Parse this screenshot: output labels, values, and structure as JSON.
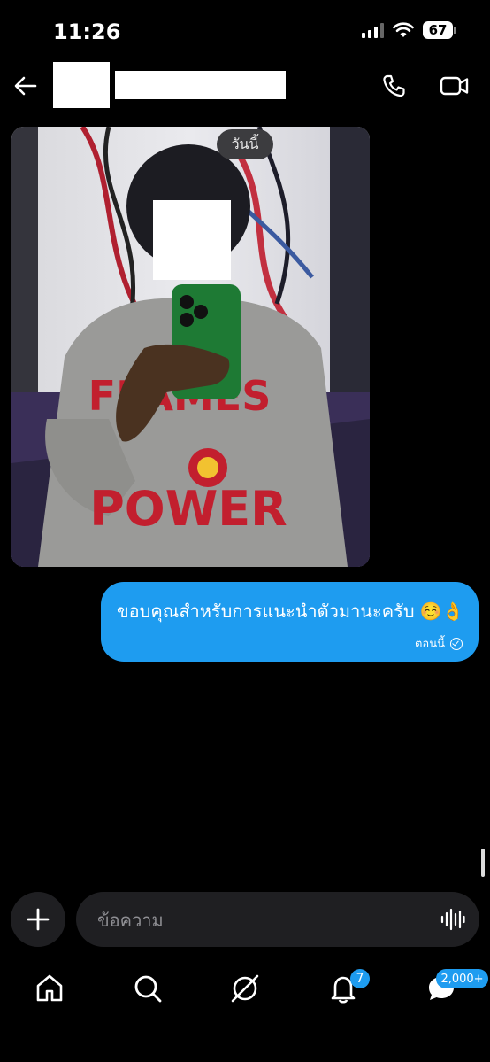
{
  "status_bar": {
    "time": "11:26",
    "battery": "67"
  },
  "header": {
    "back_icon": "arrow-left-icon",
    "call_icon": "phone-icon",
    "video_icon": "video-camera-icon"
  },
  "conversation": {
    "date_divider": "วันนี้",
    "sent_message": {
      "text": "ขอบคุณสำหรับการแนะนำตัวมานะครับ ☺️👌",
      "time": "ตอนนี้",
      "status_icon": "sent-check-icon"
    }
  },
  "composer": {
    "placeholder": "ข้อความ",
    "add_icon": "plus-icon",
    "voice_icon": "voice-waveform-icon"
  },
  "tabbar": {
    "items": [
      {
        "name": "home",
        "icon": "home-icon"
      },
      {
        "name": "search",
        "icon": "search-icon"
      },
      {
        "name": "explore",
        "icon": "compass-icon"
      },
      {
        "name": "notifications",
        "icon": "bell-icon",
        "badge": "7"
      },
      {
        "name": "messages",
        "icon": "chat-bubble-icon",
        "badge": "2,000+"
      }
    ]
  },
  "colors": {
    "accent": "#1e9cf0",
    "background": "#000000",
    "input_bg": "#1f1f22"
  }
}
